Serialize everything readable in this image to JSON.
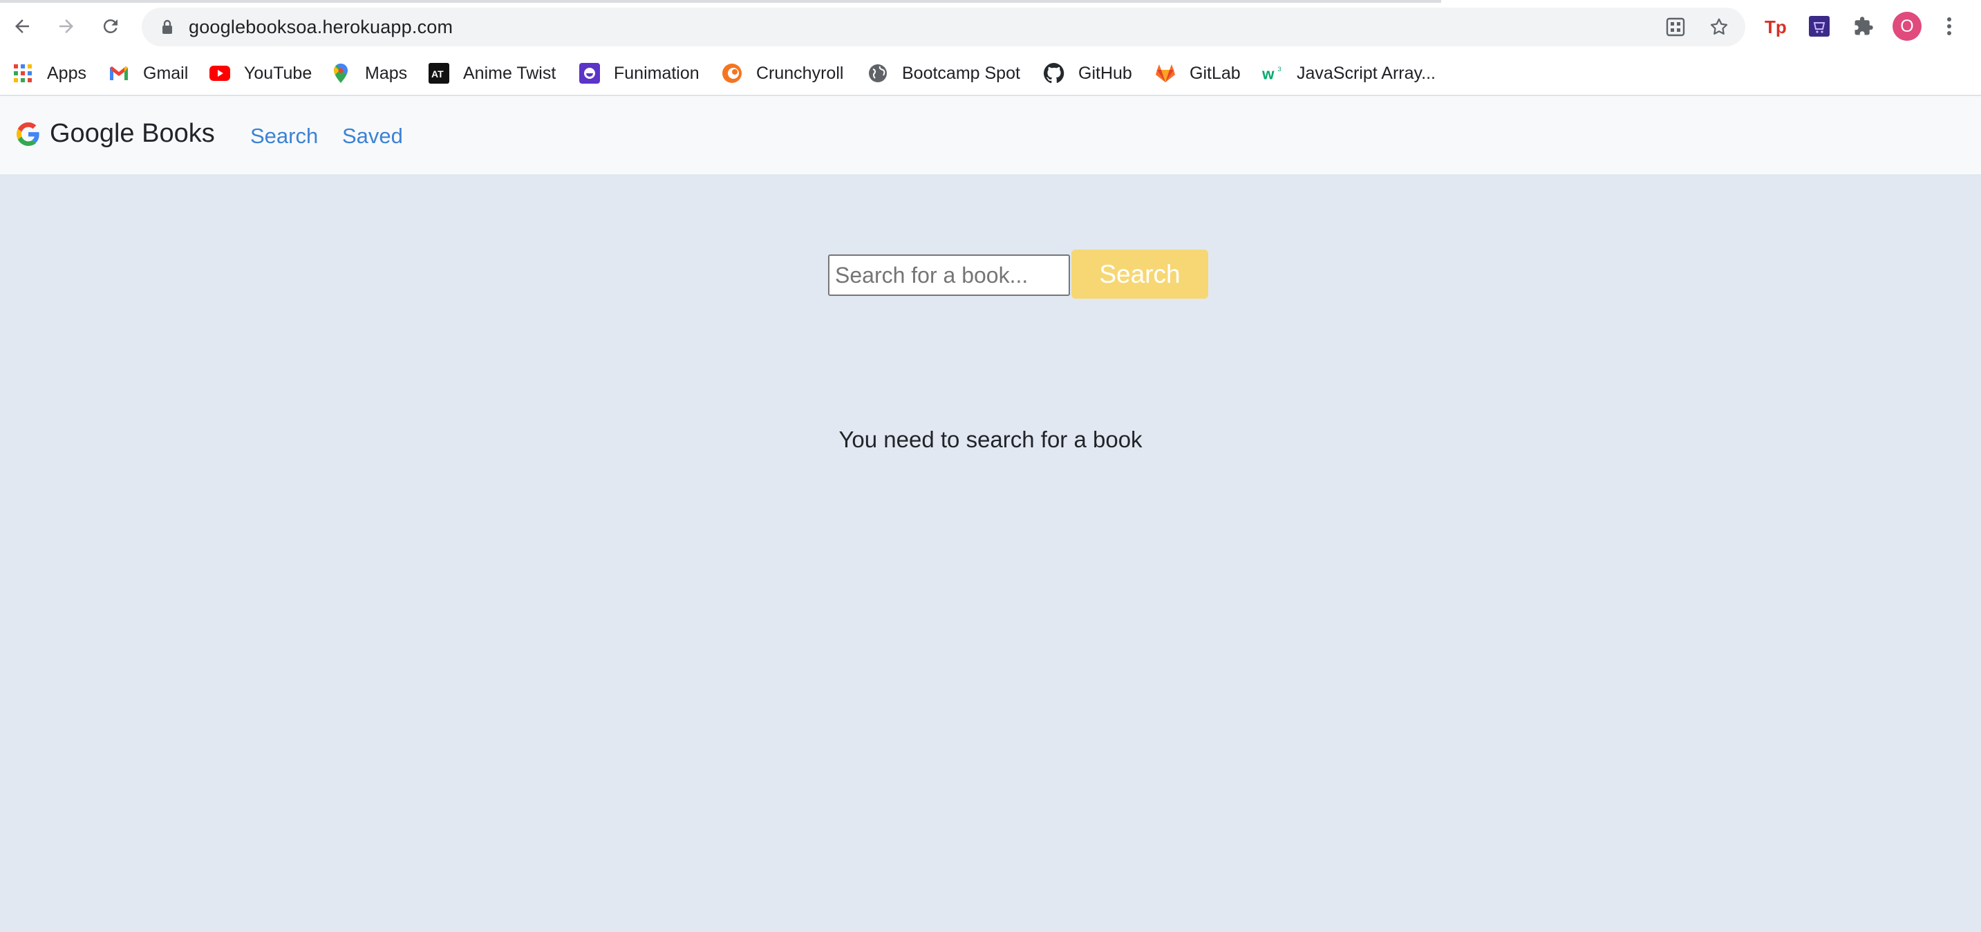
{
  "browser": {
    "url": "googlebooksoa.herokuapp.com",
    "profile_initial": "O",
    "bookmarks": [
      {
        "label": "Apps",
        "icon": "apps-grid-icon"
      },
      {
        "label": "Gmail",
        "icon": "gmail-icon"
      },
      {
        "label": "YouTube",
        "icon": "youtube-icon"
      },
      {
        "label": "Maps",
        "icon": "maps-pin-icon"
      },
      {
        "label": "Anime Twist",
        "icon": "anime-twist-icon"
      },
      {
        "label": "Funimation",
        "icon": "funimation-icon"
      },
      {
        "label": "Crunchyroll",
        "icon": "crunchyroll-icon"
      },
      {
        "label": "Bootcamp Spot",
        "icon": "globe-icon"
      },
      {
        "label": "GitHub",
        "icon": "github-icon"
      },
      {
        "label": "GitLab",
        "icon": "gitlab-icon"
      },
      {
        "label": "JavaScript Array...",
        "icon": "w3schools-icon"
      }
    ]
  },
  "navbar": {
    "brand": "Google Books",
    "links": [
      {
        "label": "Search"
      },
      {
        "label": "Saved"
      }
    ]
  },
  "search": {
    "placeholder": "Search for a book...",
    "button_label": "Search"
  },
  "message": "You need to search for a book",
  "colors": {
    "page_bg": "#e1e8f2",
    "navbar_bg": "#f8f9fa",
    "link": "#3b82d6",
    "button_bg": "#f7d774",
    "avatar": "#e04a7d"
  }
}
